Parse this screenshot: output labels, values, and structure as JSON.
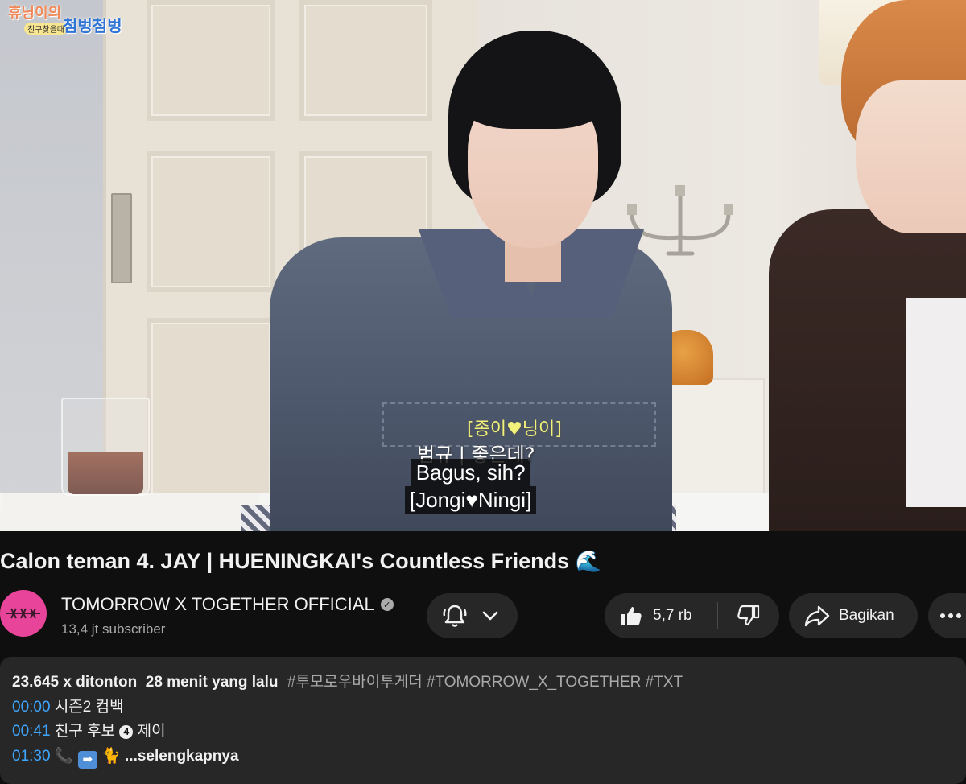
{
  "video": {
    "corner_logo_line1": "휴닝이의",
    "corner_logo_line2": "친구찾을때",
    "corner_logo_line3": "첨벙첨벙",
    "burned_subtitle_top": "[종이♥닝이]",
    "burned_subtitle_bottom": "범규 | 좋은데?",
    "caption_line1": "Bagus, sih?",
    "caption_line2": "[Jongi♥Ningi]"
  },
  "title": {
    "text": "Calon teman 4. JAY | HUENINGKAI's Countless Friends",
    "emoji": "🌊"
  },
  "channel": {
    "name": "TOMORROW X TOGETHER OFFICIAL",
    "verified_icon": "verified-check-icon",
    "subscribers": "13,4 jt subscriber",
    "avatar_color": "#e8459a"
  },
  "actions": {
    "notification_icon": "bell-icon",
    "like_icon": "thumbs-up-icon",
    "like_count": "5,7 rb",
    "dislike_icon": "thumbs-down-icon",
    "share_icon": "share-arrow-icon",
    "share_label": "Bagikan",
    "more_icon": "more-horizontal-icon"
  },
  "description": {
    "views": "23.645 x ditonton",
    "time_ago": "28 menit yang lalu",
    "hashtags": "#투모로우바이투게더 #TOMORROW_X_TOGETHER #TXT",
    "chapters": [
      {
        "time": "00:00",
        "text": "시즌2 컴백"
      },
      {
        "time": "00:41",
        "text_before": "친구 후보",
        "number": "4",
        "text_after": "제이"
      },
      {
        "time": "01:30",
        "emojis": "📞",
        "arrow": "➡",
        "animal": "🐈"
      }
    ],
    "more_label": "...selengkapnya"
  },
  "colors": {
    "background": "#0f0f0f",
    "surface": "#272727",
    "link": "#3ea6ff",
    "secondary_text": "#aaaaaa"
  }
}
